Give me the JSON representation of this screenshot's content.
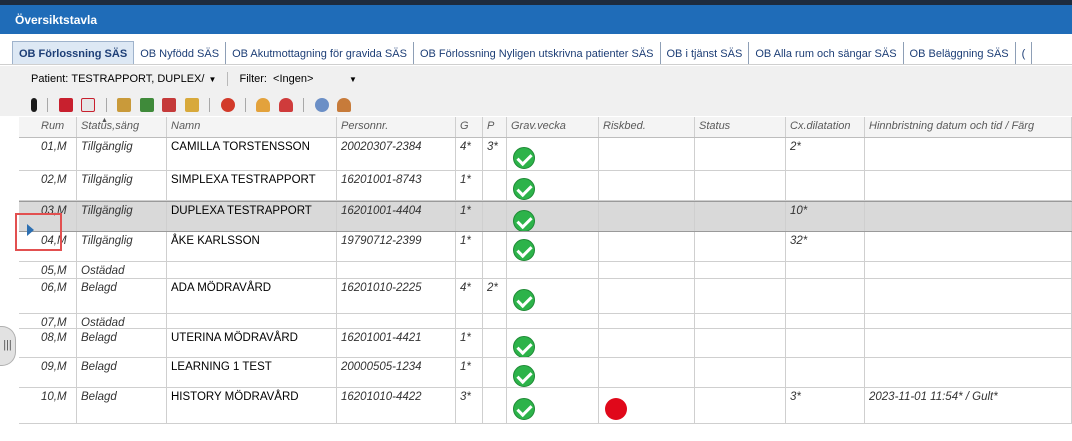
{
  "window": {
    "title": "Översiktstavla"
  },
  "tabs": [
    "OB Förlossning SÄS",
    "OB Nyfödd SÄS",
    "OB Akutmottagning för gravida SÄS",
    "OB Förlossning Nyligen utskrivna patienter SÄS",
    "OB i tjänst SÄS",
    "OB Alla rum och sängar SÄS",
    "OB Beläggning SÄS",
    "("
  ],
  "filter": {
    "patient_label": "Patient:",
    "patient_value": "TESTRAPPORT, DUPLEX/",
    "filter_label": "Filter:",
    "filter_value": "<Ingen>"
  },
  "columns": [
    "Rum",
    "Status,säng",
    "Namn",
    "Personnr.",
    "G",
    "P",
    "Grav.vecka",
    "Riskbed.",
    "Status",
    "Cx.dilatation",
    "Hinnbristning datum och tid / Färg"
  ],
  "rows": [
    {
      "rum": "01,M",
      "status": "Tillgänglig",
      "namn": "CAMILLA TORSTENSSON",
      "personnr": "20020307-2384",
      "g": "4*",
      "p": "3*",
      "grav": "check",
      "risk": "",
      "st": "",
      "cx": "2*",
      "hinn": ""
    },
    {
      "rum": "02,M",
      "status": "Tillgänglig",
      "namn": "SIMPLEXA TESTRAPPORT",
      "personnr": "16201001-8743",
      "g": "1*",
      "p": "",
      "grav": "check",
      "risk": "",
      "st": "",
      "cx": "",
      "hinn": ""
    },
    {
      "rum": "03,M",
      "status": "Tillgänglig",
      "namn": "DUPLEXA TESTRAPPORT",
      "personnr": "16201001-4404",
      "g": "1*",
      "p": "",
      "grav": "check",
      "risk": "",
      "st": "",
      "cx": "10*",
      "hinn": ""
    },
    {
      "rum": "04,M",
      "status": "Tillgänglig",
      "namn": "ÅKE KARLSSON",
      "personnr": "19790712-2399",
      "g": "1*",
      "p": "",
      "grav": "check",
      "risk": "",
      "st": "",
      "cx": "32*",
      "hinn": ""
    },
    {
      "rum": "05,M",
      "status": "Ostädad",
      "namn": "",
      "personnr": "",
      "g": "",
      "p": "",
      "grav": "",
      "risk": "",
      "st": "",
      "cx": "",
      "hinn": ""
    },
    {
      "rum": "06,M",
      "status": "Belagd",
      "namn": "ADA MÖDRAVÅRD",
      "personnr": "16201010-2225",
      "g": "4*",
      "p": "2*",
      "grav": "check",
      "risk": "",
      "st": "",
      "cx": "",
      "hinn": ""
    },
    {
      "rum": "07,M",
      "status": "Ostädad",
      "namn": "",
      "personnr": "",
      "g": "",
      "p": "",
      "grav": "",
      "risk": "",
      "st": "",
      "cx": "",
      "hinn": ""
    },
    {
      "rum": "08,M",
      "status": "Belagd",
      "namn": "UTERINA MÖDRAVÅRD",
      "personnr": "16201001-4421",
      "g": "1*",
      "p": "",
      "grav": "check",
      "risk": "",
      "st": "",
      "cx": "",
      "hinn": ""
    },
    {
      "rum": "09,M",
      "status": "Belagd",
      "namn": "LEARNING 1 TEST",
      "personnr": "20000505-1234",
      "g": "1*",
      "p": "",
      "grav": "check",
      "risk": "",
      "st": "",
      "cx": "",
      "hinn": ""
    },
    {
      "rum": "10,M",
      "status": "Belagd",
      "namn": "HISTORY MÖDRAVÅRD",
      "personnr": "16201010-4422",
      "g": "3*",
      "p": "",
      "grav": "check",
      "risk": "red-dot",
      "st": "",
      "cx": "3*",
      "hinn": "2023-11-01 11:54* / Gult*"
    }
  ],
  "selected_row": 2,
  "icons": [
    "figure-icon",
    "calendar-icon",
    "document-icon",
    "tools-icon",
    "chart-icon",
    "chart-red-icon",
    "folder-icon",
    "lifebuoy-icon",
    "person-orange-icon",
    "person-red-icon",
    "baby-icon",
    "woman-icon"
  ],
  "colors": {
    "title_bar": "#1f6cb8",
    "selected_row": "#d9d9d9",
    "check": "#2db34a",
    "risk_red": "#e0081a"
  }
}
